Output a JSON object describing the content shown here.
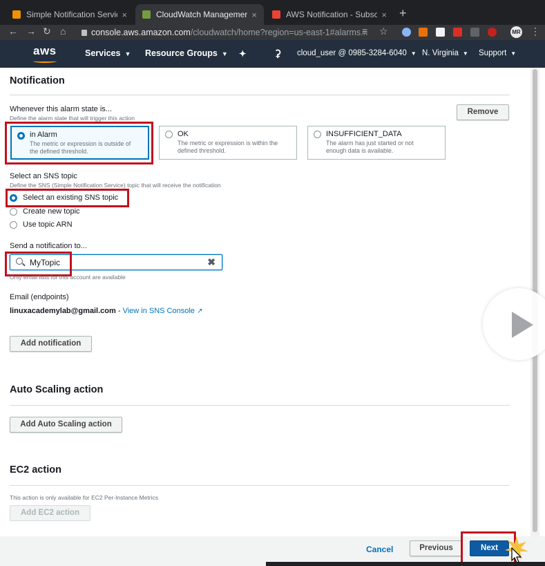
{
  "browser": {
    "tabs": [
      {
        "title": "Simple Notification Service",
        "favicon_color": "#f29100"
      },
      {
        "title": "CloudWatch Management Con",
        "favicon_color": "#759c3e"
      },
      {
        "title": "AWS Notification - Subscriptio",
        "favicon_color": "#ea4335"
      }
    ],
    "close_glyph": "×",
    "new_tab_glyph": "+",
    "url_host": "console.aws.amazon.com",
    "url_path": "/cloudwatch/home?region=us-east-1#alarms...",
    "avatar_initials": "MR"
  },
  "aws_nav": {
    "logo": "aws",
    "services": "Services",
    "resource_groups": "Resource Groups",
    "user": "cloud_user @ 0985-3284-6040",
    "region": "N. Virginia",
    "support": "Support"
  },
  "notification": {
    "title": "Notification",
    "state_label": "Whenever this alarm state is...",
    "state_desc": "Define the alarm state that will trigger this action",
    "remove_label": "Remove",
    "states": [
      {
        "title": "in Alarm",
        "desc1": "The metric or expression is outside of",
        "desc2": "the defined threshold.",
        "selected": true
      },
      {
        "title": "OK",
        "desc1": "The metric or expression is within the",
        "desc2": "defined threshold.",
        "selected": false
      },
      {
        "title": "INSUFFICIENT_DATA",
        "desc1": "The alarm has just started or not",
        "desc2": "enough data is available.",
        "selected": false
      }
    ],
    "sns_label": "Select an SNS topic",
    "sns_desc": "Define the SNS (Simple Notification Service) topic that will receive the notification",
    "sns_options": [
      {
        "label": "Select an existing SNS topic",
        "selected": true
      },
      {
        "label": "Create new topic",
        "selected": false
      },
      {
        "label": "Use topic ARN",
        "selected": false
      }
    ],
    "send_label": "Send a notification to...",
    "search_value": "MyTopic",
    "search_hint": "Only email lists for this account are available",
    "email_label": "Email (endpoints)",
    "email_value": "linuxacademylab@gmail.com",
    "email_sep": " - ",
    "view_link": "View in SNS Console",
    "add_notification": "Add notification"
  },
  "autoscaling": {
    "title": "Auto Scaling action",
    "add_label": "Add Auto Scaling action"
  },
  "ec2": {
    "title": "EC2 action",
    "note": "This action is only available for EC2 Per-Instance Metrics",
    "add_label": "Add EC2 action"
  },
  "footer": {
    "cancel": "Cancel",
    "previous": "Previous",
    "next": "Next"
  },
  "colors": {
    "highlight_box": "#c0111d",
    "aws_nav_bg": "#232f3e",
    "primary_blue": "#0073bb",
    "next_button": "#0e5ba3"
  }
}
